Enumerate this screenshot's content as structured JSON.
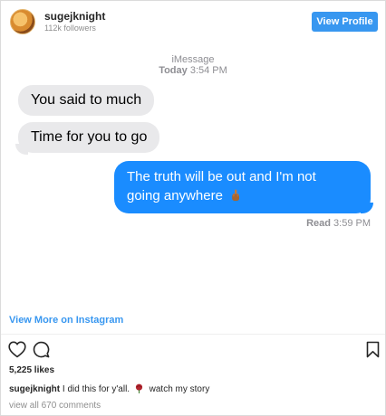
{
  "header": {
    "username": "sugejknight",
    "followers": "112k followers",
    "view_profile": "View Profile"
  },
  "imessage": {
    "service": "iMessage",
    "time_day": "Today",
    "time_clock": "3:54 PM",
    "incoming": [
      "You said to much",
      "Time for you to go"
    ],
    "outgoing_line1": "The truth will be out and I'm not",
    "outgoing_line2": "going anywhere",
    "read_label": "Read",
    "read_time": "3:59 PM"
  },
  "embed": {
    "view_more": "View More on Instagram"
  },
  "post": {
    "likes": "5,225 likes",
    "caption_user": "sugejknight",
    "caption_text_1": "I did this for y'all.",
    "caption_text_2": "watch my story",
    "comments": "view all 670 comments"
  },
  "icons": {
    "avatar": "avatar-image",
    "emoji_outgoing": "middle-finger-emoji",
    "emoji_caption": "rose-emoji",
    "like": "heart-icon",
    "comment": "comment-icon",
    "save": "bookmark-icon"
  },
  "colors": {
    "accent": "#3897f0",
    "bubble_out": "#1a8cff",
    "bubble_in": "#e9e9eb"
  }
}
